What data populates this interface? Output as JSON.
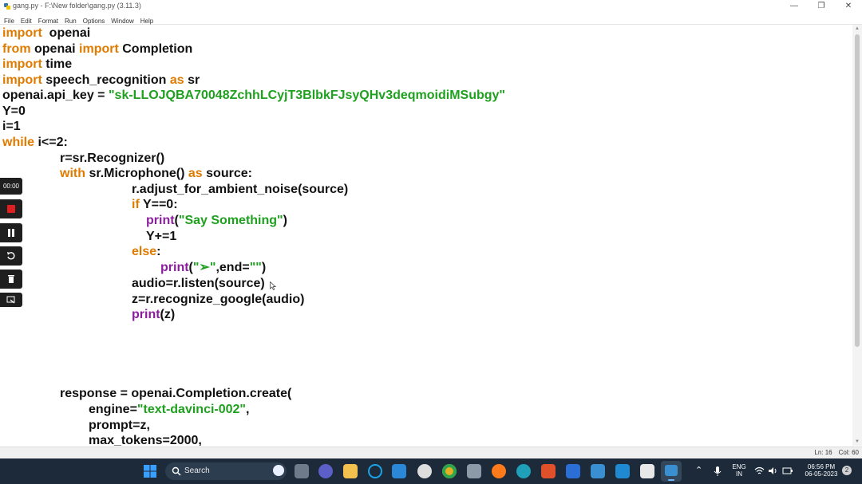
{
  "window": {
    "title": "gang.py - F:\\New folder\\gang.py (3.11.3)",
    "minimize_glyph": "—",
    "maximize_glyph": "❐",
    "close_glyph": "✕"
  },
  "menu": [
    "File",
    "Edit",
    "Format",
    "Run",
    "Options",
    "Window",
    "Help"
  ],
  "code": {
    "line1": {
      "kw1": "import",
      "rest": "  openai"
    },
    "line2": {
      "kw1": "from",
      "mid": " openai ",
      "kw2": "import",
      "rest": " Completion"
    },
    "line3": {
      "kw1": "import",
      "rest": " time"
    },
    "line4": {
      "kw1": "import",
      "mid": " speech_recognition ",
      "kw2": "as",
      "rest": " sr"
    },
    "line5": {
      "pre": "openai.api_key = ",
      "str": "\"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\""
    },
    "line6": {
      "text": "Y=0"
    },
    "line7": {
      "text": "i=1"
    },
    "line8": {
      "kw1": "while",
      "rest": " i<=2:"
    },
    "line9": {
      "text": "r=sr.Recognizer()"
    },
    "line10": {
      "kw1": "with",
      "mid": " sr.Microphone() ",
      "kw2": "as",
      "rest": " source:"
    },
    "line11": {
      "text": "r.adjust_for_ambient_noise(source)"
    },
    "line12": {
      "kw1": "if",
      "rest": " Y==0:"
    },
    "line13": {
      "fn": "print",
      "pre": "(",
      "str": "\"Say Something\"",
      "rest": ")"
    },
    "line14": {
      "text": "Y+=1"
    },
    "line15": {
      "kw1": "else",
      "rest": ":"
    },
    "line16": {
      "fn": "print",
      "pre": "(",
      "str": "\"➢\"",
      "mid": ",end=",
      "str2": "\"\"",
      "rest": ")"
    },
    "line17": {
      "text": "audio=r.listen(source)"
    },
    "line18": {
      "text": "z=r.recognize_google(audio)"
    },
    "line19": {
      "fn": "print",
      "rest": "(z)"
    },
    "line20": {
      "text": "response = openai.Completion.create("
    },
    "line21": {
      "pre": "engine=",
      "str": "\"text-davinci-002\"",
      "rest": ","
    },
    "line22": {
      "text": "prompt=z,"
    },
    "line23": {
      "text": "max_tokens=2000,"
    }
  },
  "colors": {
    "keyword": "#e07b00",
    "string": "#1fa01f",
    "builtin": "#8a1e9c"
  },
  "recorder": {
    "time": "00:00"
  },
  "status": {
    "line": "Ln: 16",
    "col": "Col: 60"
  },
  "taskbar": {
    "search_label": "Search",
    "lang1": "ENG",
    "lang2": "IN",
    "time": "06:56 PM",
    "date": "06-05-2023",
    "notif_count": "2"
  }
}
